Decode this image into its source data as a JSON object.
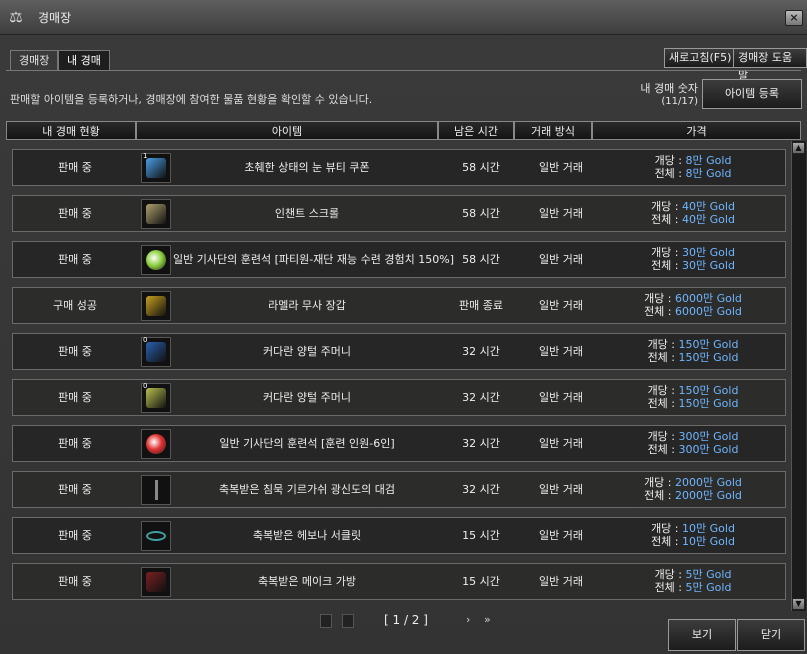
{
  "window": {
    "title": "경매장"
  },
  "tabs": [
    {
      "label": "경매장"
    },
    {
      "label": "내 경매"
    }
  ],
  "toolbar": {
    "refresh_label": "새로고침(F5)",
    "help_label": "경매장 도움말"
  },
  "description": "판매할 아이템을 등록하거나, 경매장에 참여한 물품 현황을 확인할 수 있습니다.",
  "auction_count": {
    "label": "내 경매 숫자",
    "value": "(11/17)"
  },
  "register_button": "아이템 등록",
  "columns": [
    "내 경매 현황",
    "아이템",
    "남은 시간",
    "거래 방식",
    "가격"
  ],
  "rows": [
    {
      "status": "판매 중",
      "qty": "1",
      "name": "초췌한 상태의 눈 뷰티 쿠폰",
      "time": "58 시간",
      "method": "일반 거래",
      "unit_label": "개당 : ",
      "unit_price": "8만 Gold",
      "total_label": "전체 : ",
      "total_price": "8만 Gold",
      "icon": "coupon-icon",
      "icon_color": "#4a9ee8"
    },
    {
      "status": "판매 중",
      "qty": "",
      "name": "인챈트 스크롤",
      "time": "58 시간",
      "method": "일반 거래",
      "unit_label": "개당 : ",
      "unit_price": "40만 Gold",
      "total_label": "전체 : ",
      "total_price": "40만 Gold",
      "icon": "scroll-icon",
      "icon_color": "#b0a070"
    },
    {
      "status": "판매 중",
      "qty": "",
      "name": "일반 기사단의 훈련석 [파티원-재단 재능 수련 경험치 150%]",
      "time": "58 시간",
      "method": "일반 거래",
      "unit_label": "개당 : ",
      "unit_price": "30만 Gold",
      "total_label": "전체 : ",
      "total_price": "30만 Gold",
      "icon": "green-orb-icon",
      "icon_color": "#8ed040"
    },
    {
      "status": "구매 성공",
      "qty": "",
      "name": "라멜라 무사 장갑",
      "time": "판매 종료",
      "method": "일반 거래",
      "unit_label": "개당 : ",
      "unit_price": "6000만 Gold",
      "total_label": "전체 : ",
      "total_price": "6000만 Gold",
      "icon": "gloves-icon",
      "icon_color": "#c8a020"
    },
    {
      "status": "판매 중",
      "qty": "0",
      "name": "커다란 양털 주머니",
      "time": "32 시간",
      "method": "일반 거래",
      "unit_label": "개당 : ",
      "unit_price": "150만 Gold",
      "total_label": "전체 : ",
      "total_price": "150만 Gold",
      "icon": "blue-pouch-icon",
      "icon_color": "#2a60b0"
    },
    {
      "status": "판매 중",
      "qty": "0",
      "name": "커다란 양털 주머니",
      "time": "32 시간",
      "method": "일반 거래",
      "unit_label": "개당 : ",
      "unit_price": "150만 Gold",
      "total_label": "전체 : ",
      "total_price": "150만 Gold",
      "icon": "yellow-pouch-icon",
      "icon_color": "#b8c050"
    },
    {
      "status": "판매 중",
      "qty": "",
      "name": "일반 기사단의 훈련석 [훈련 인원-6인]",
      "time": "32 시간",
      "method": "일반 거래",
      "unit_label": "개당 : ",
      "unit_price": "300만 Gold",
      "total_label": "전체 : ",
      "total_price": "300만 Gold",
      "icon": "red-orb-icon",
      "icon_color": "#e03030"
    },
    {
      "status": "판매 중",
      "qty": "",
      "name": "축복받은 침묵 기르가쉬 광신도의 대검",
      "time": "32 시간",
      "method": "일반 거래",
      "unit_label": "개당 : ",
      "unit_price": "2000만 Gold",
      "total_label": "전체 : ",
      "total_price": "2000만 Gold",
      "icon": "sword-icon",
      "icon_color": "#888888"
    },
    {
      "status": "판매 중",
      "qty": "",
      "name": "축복받은 헤보나 서클릿",
      "time": "15 시간",
      "method": "일반 거래",
      "unit_label": "개당 : ",
      "unit_price": "10만 Gold",
      "total_label": "전체 : ",
      "total_price": "10만 Gold",
      "icon": "circlet-icon",
      "icon_color": "#40a0a0"
    },
    {
      "status": "판매 중",
      "qty": "",
      "name": "축복받은 메이크 가방",
      "time": "15 시간",
      "method": "일반 거래",
      "unit_label": "개당 : ",
      "unit_price": "5만 Gold",
      "total_label": "전체 : ",
      "total_price": "5만 Gold",
      "icon": "bag-icon",
      "icon_color": "#7a2020"
    }
  ],
  "pager": {
    "text": "[ 1 / 2 ]",
    "next": "›",
    "last": "»"
  },
  "buttons": {
    "view": "보기",
    "close": "닫기"
  },
  "colors": {
    "gold_text": "#6fb6ff"
  }
}
